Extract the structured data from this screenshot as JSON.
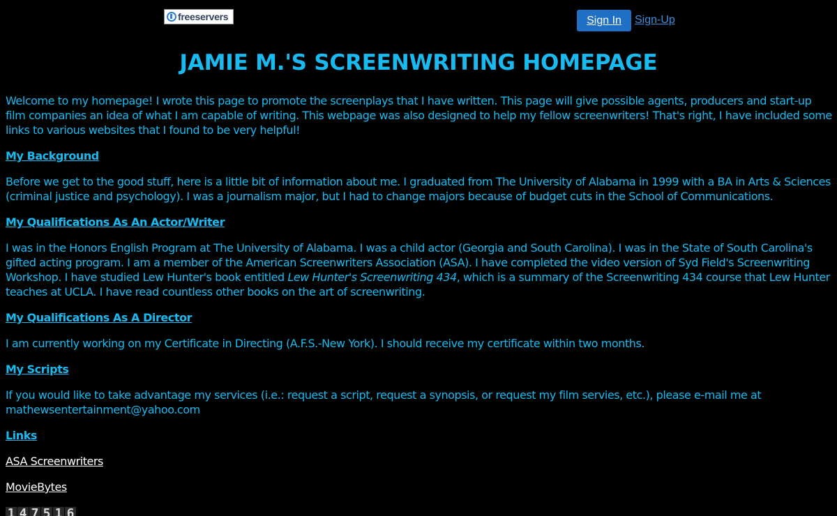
{
  "topbar": {
    "logo_text": "freeservers",
    "signin_label": "Sign In",
    "signup_label": "Sign-Up"
  },
  "page_title": "JAMIE M.'S SCREENWRITING HOMEPAGE",
  "intro": "Welcome to my homepage! I wrote this page to promote the screenplays that I have written. This page will give possible agents, producers and start-up film companies an idea of what I am capable of writing. This webpage was also designed to help my fellow screenwriters! That's right, I have included some links to various websites that I found to be very helpful!",
  "background": {
    "heading": "My Background",
    "text": "Before we get to the good stuff, here is a little bit of information about me. I graduated from The University of Alabama in 1999 with a BA in Arts & Sciences (criminal justice and psychology). I was a journalism major, but I had to change majors because of budget cuts in the School of Communications."
  },
  "actor_writer": {
    "heading": "My Qualifications As An Actor/Writer",
    "text_before": "I was in the Honors English Program at The University of Alabama. I was a child actor (Georgia and South Carolina). I was in the State of South Carolina's gifted acting program. I am a member of the American Screenwriters Association (ASA). I have completed the video version of Syd Field's Screenwriting Workshop. I have studied Lew Hunter's book entitled ",
    "book_title": "Lew Hunter's Screenwriting 434",
    "text_after": ", which is a summary of the Screenwriting 434 course that Lew Hunter teaches at UCLA. I have read countless other books on the art of screenwriting."
  },
  "director": {
    "heading": "My Qualifications As A Director",
    "text": "I am currently working on my Certificate in Directing (A.F.S.-New York). I should receive my certificate within two months."
  },
  "scripts": {
    "heading": "My Scripts",
    "text": "If you would like to take advantage my services (i.e.: request a script, request a synopsis, or request my film servies, etc.), please e-mail me at",
    "email": "mathewsentertainment@yahoo.com"
  },
  "links": {
    "heading": "Links",
    "items": [
      "ASA Screenwriters",
      "MovieBytes"
    ]
  },
  "counter": {
    "digits": [
      "1",
      "4",
      "7",
      "5",
      "1",
      "6"
    ]
  },
  "colors": {
    "background": "#000000",
    "text": "#19baf0",
    "link_white": "#ffffff",
    "signin_bg": "#1f6fc4"
  }
}
